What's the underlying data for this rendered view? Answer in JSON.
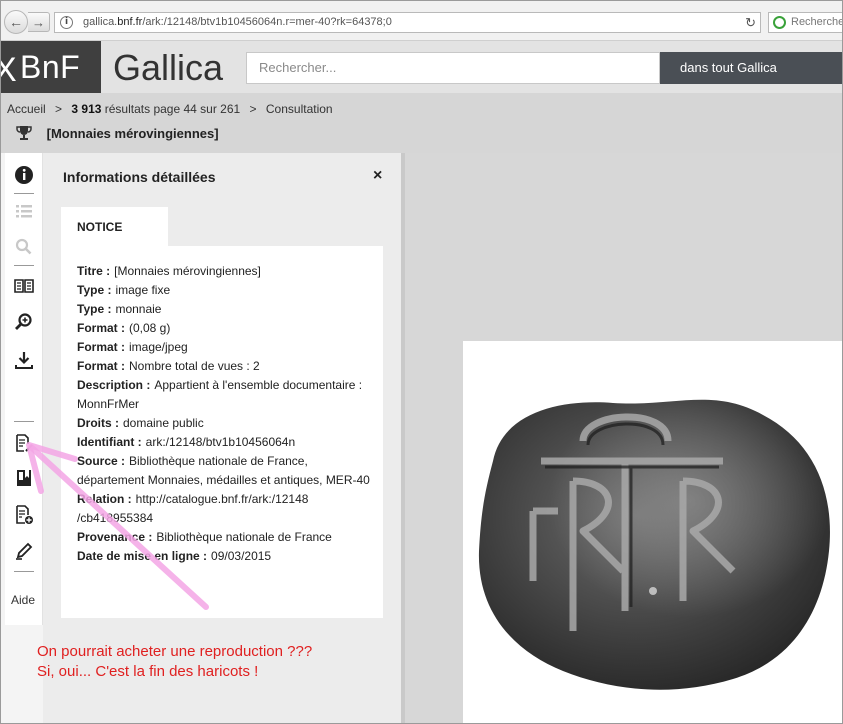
{
  "browser": {
    "url_prefix": "gallica.",
    "url_domain": "bnf.fr",
    "url_path": "/ark:/12148/btv1b10456064n.r=mer-40?rk=64378;0",
    "search_placeholder": "Recherche"
  },
  "header": {
    "logo": "BnF",
    "title": "Gallica",
    "search_placeholder": "Rechercher...",
    "scope": "dans tout Gallica"
  },
  "breadcrumb": {
    "home": "Accueil",
    "sep": ">",
    "results_count": "3 913",
    "results_text": "résultats page 44 sur 261",
    "current": "Consultation"
  },
  "document_title": "[Monnaies mérovingiennes]",
  "toolbar": {
    "help_label": "Aide"
  },
  "panel": {
    "title": "Informations détaillées",
    "close": "×",
    "tab": "NOTICE",
    "fields": [
      {
        "key": "Titre :",
        "value": "[Monnaies mérovingiennes]"
      },
      {
        "key": "Type :",
        "value": "image fixe"
      },
      {
        "key": "Type :",
        "value": "monnaie"
      },
      {
        "key": "Format :",
        "value": "(0,08 g)"
      },
      {
        "key": "Format :",
        "value": "image/jpeg"
      },
      {
        "key": "Format :",
        "value": "Nombre total de vues : 2"
      },
      {
        "key": "Description :",
        "value": "Appartient à l'ensemble documentaire : MonnFrMer"
      },
      {
        "key": "Droits :",
        "value": "domaine public"
      },
      {
        "key": "Identifiant :",
        "value": "ark:/12148/btv1b10456064n"
      },
      {
        "key": "Source :",
        "value": "Bibliothèque nationale de France, département Monnaies, médailles et antiques, MER-40"
      },
      {
        "key": "Relation :",
        "value": "http://catalogue.bnf.fr/ark:/12148 /cb418955384"
      },
      {
        "key": "Provenance :",
        "value": "Bibliothèque nationale de France"
      },
      {
        "key": "Date de mise en ligne :",
        "value": "09/03/2015"
      }
    ]
  },
  "annotation": {
    "line1": "On pourrait acheter une reproduction ???",
    "line2": "Si, oui... C'est la fin des haricots !",
    "color": "#e02020",
    "arrow_color": "#f4a6e6"
  }
}
